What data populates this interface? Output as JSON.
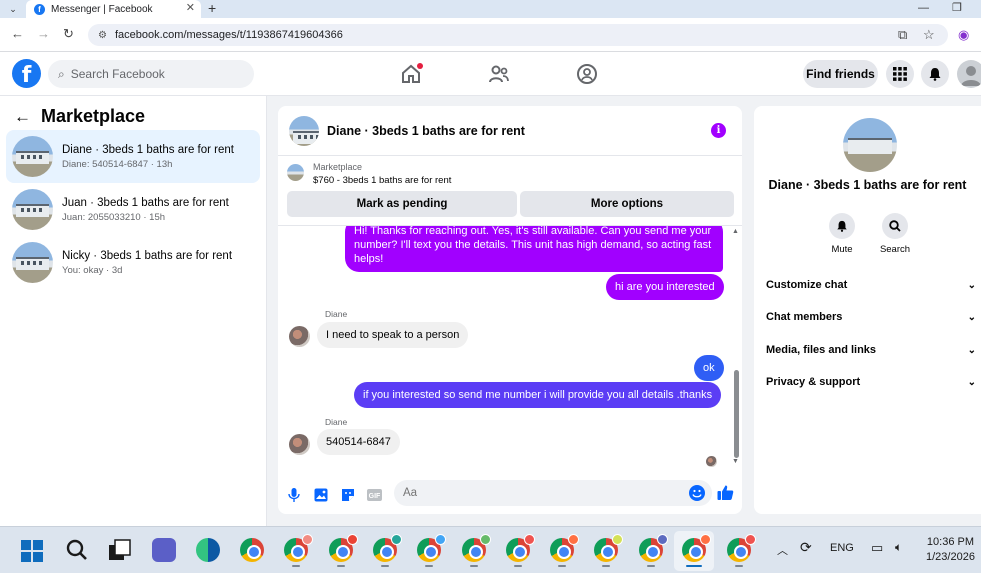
{
  "browser": {
    "tab_title": "Messenger | Facebook",
    "url": "facebook.com/messages/t/1193867419604366"
  },
  "fbnav": {
    "search_placeholder": "Search Facebook",
    "find_friends": "Find friends"
  },
  "sidebar": {
    "title": "Marketplace",
    "conversations": [
      {
        "name": "Diane · 3beds 1 baths are for rent",
        "preview": "Diane: 540514-6847 · 13h"
      },
      {
        "name": "Juan · 3beds 1 baths are for rent",
        "preview": "Juan: 2055033210 · 15h"
      },
      {
        "name": "Nicky · 3beds 1 baths are for rent",
        "preview": "You: okay · 3d"
      }
    ]
  },
  "chat": {
    "title": "Diane · 3beds 1 baths are for rent",
    "listing_label": "Marketplace",
    "listing_price": "$760 - 3beds 1 baths are for rent",
    "mark_pending": "Mark as pending",
    "more_options": "More options",
    "messages": {
      "m1": "Hi! Thanks for reaching out. Yes, it's still available. Can you send me your number? I'll text you the details. This unit has high demand, so acting fast helps!",
      "m2": "hi are you interested",
      "sender1": "Diane",
      "m3": "I need to speak to a person",
      "m4": "ok",
      "m5": "if you interested so send me number i will provide you all details .thanks",
      "sender2": "Diane",
      "m6": "540514-6847"
    },
    "composer_placeholder": "Aa"
  },
  "details": {
    "name": "Diane · 3beds 1 baths are for rent",
    "mute": "Mute",
    "search": "Search",
    "sections": [
      "Customize chat",
      "Chat members",
      "Media, files and links",
      "Privacy & support"
    ]
  },
  "taskbar": {
    "lang": "ENG",
    "time": "10:36 PM",
    "date": "1/23/2026"
  },
  "colors": {
    "fb_blue": "#1877f2",
    "outgoing_purple": "#a100ff",
    "outgoing_blue": "#5b3df5",
    "active_conv": "#e7f3ff"
  }
}
